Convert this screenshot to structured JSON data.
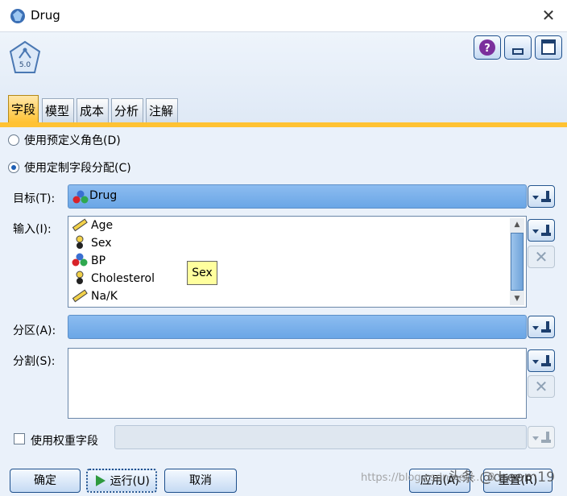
{
  "window": {
    "title": "Drug",
    "close_glyph": "✕"
  },
  "tabs": [
    {
      "label": "字段",
      "active": true
    },
    {
      "label": "模型",
      "active": false
    },
    {
      "label": "成本",
      "active": false
    },
    {
      "label": "分析",
      "active": false
    },
    {
      "label": "注解",
      "active": false
    }
  ],
  "node_badge": {
    "version": "5.0"
  },
  "role_options": [
    {
      "label": "使用预定义角色(D)",
      "selected": false
    },
    {
      "label": "使用定制字段分配(C)",
      "selected": true
    }
  ],
  "target": {
    "label": "目标(T):",
    "value": "Drug",
    "icon": "nominal-field-icon"
  },
  "inputs": {
    "label": "输入(I):",
    "items": [
      {
        "name": "Age",
        "icon": "continuous-ruler-icon"
      },
      {
        "name": "Sex",
        "icon": "flag-field-icon"
      },
      {
        "name": "BP",
        "icon": "nominal-field-icon"
      },
      {
        "name": "Cholesterol",
        "icon": "flag-field-icon"
      },
      {
        "name": "Na/K",
        "icon": "continuous-ruler-icon"
      }
    ],
    "tooltip": "Sex"
  },
  "partition": {
    "label": "分区(A):",
    "value": ""
  },
  "split": {
    "label": "分割(S):"
  },
  "weight": {
    "label": "使用权重字段",
    "checked": false,
    "value": ""
  },
  "footer": {
    "ok": "确定",
    "run": "运行(U)",
    "cancel": "取消",
    "apply": "应用(A)",
    "reset": "重置(R)"
  },
  "watermark": {
    "text1": "https://blog.csdn.net/..._8",
    "text2": "头条 @dream19"
  },
  "colors": {
    "accent_tab": "#ffc233",
    "field_blue": "#7ab1ea",
    "button_border": "#1d4f8c"
  }
}
